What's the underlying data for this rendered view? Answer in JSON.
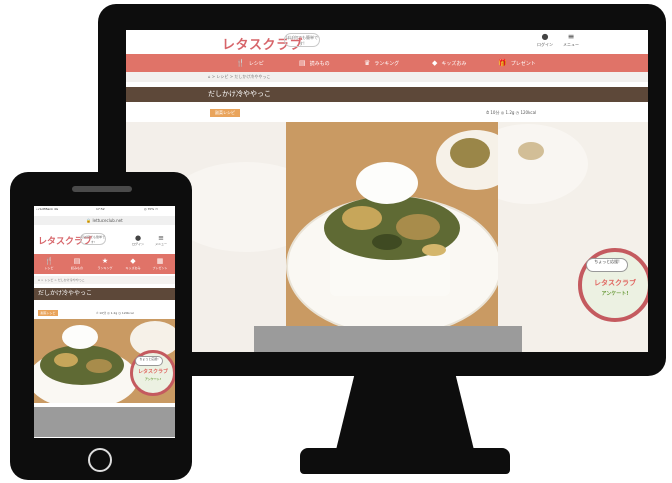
{
  "desktop": {
    "site_logo": "レタスクラブ",
    "logo_bubble": "ほぼ何でも簡単です!",
    "header_icons": [
      {
        "icon": "person-icon",
        "label": "ログイン"
      },
      {
        "icon": "menu-icon",
        "label": "メニュー"
      }
    ],
    "nav": [
      {
        "icon": "fork-knife-icon",
        "label": "レシピ"
      },
      {
        "icon": "book-icon",
        "label": "読みもの"
      },
      {
        "icon": "crown-icon",
        "label": "ランキング"
      },
      {
        "icon": "bird-icon",
        "label": "キッズおみ"
      },
      {
        "icon": "gift-icon",
        "label": "プレゼント"
      }
    ],
    "breadcrumb": "⌂ > レシピ > だしかけ冷ややっこ",
    "title": "だしかけ冷ややっこ",
    "tag": "副菜レシピ",
    "stats": "⏱ 10分  ◎ 1.2g  ◷ 120kcal",
    "badge": {
      "bubble": "ちょっと応援!",
      "logo": "レタスクラブ",
      "sub": "アンケート!"
    }
  },
  "phone": {
    "status_left": "••SoftBank 4G",
    "status_time": "17:52",
    "status_right": "◎ 70% ▭",
    "url": "🔒 lettuceclub.net",
    "site_logo": "レタスクラブ",
    "logo_bubble": "ほぼ何でも簡単です!",
    "header_icons": [
      {
        "icon": "person-icon",
        "label": "ログイン"
      },
      {
        "icon": "menu-icon",
        "label": "メニュー"
      }
    ],
    "nav": [
      {
        "icon": "fork-knife-icon",
        "label": "レシピ"
      },
      {
        "icon": "book-icon",
        "label": "読みもの"
      },
      {
        "icon": "crown-icon",
        "label": "ランキング"
      },
      {
        "icon": "bird-icon",
        "label": "キッズおみ"
      },
      {
        "icon": "gift-icon",
        "label": "プレゼント"
      }
    ],
    "breadcrumb": "⌂ > レシピ > だしかけ冷ややっこ",
    "title": "だしかけ冷ややっこ",
    "tag": "副菜レシピ",
    "stats": "⏱ 10分  ◎ 1.2g  ◷ 120kcal",
    "badge": {
      "bubble": "ちょっと応援!",
      "logo": "レタスクラブ",
      "sub": "アンケート!"
    }
  },
  "colors": {
    "nav_bg": "#e07368",
    "title_bar": "#5d4839",
    "logo": "#d7656a",
    "tag": "#e9a45c",
    "badge_ring": "#c45a5f"
  }
}
